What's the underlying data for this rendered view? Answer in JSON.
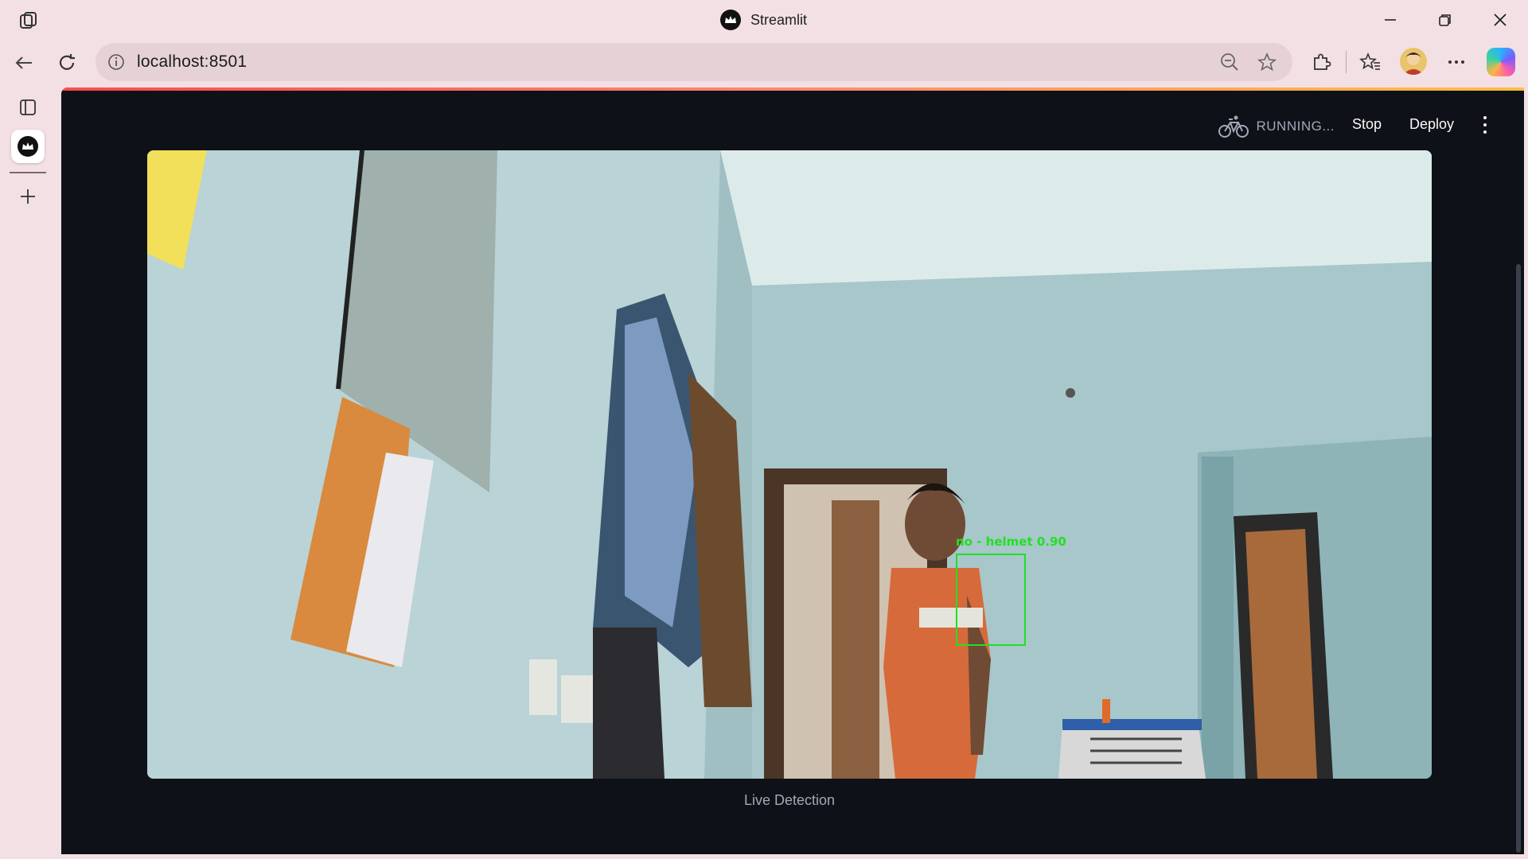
{
  "window": {
    "title": "Streamlit"
  },
  "addressbar": {
    "url": "localhost:8501"
  },
  "icons": {
    "workspaces": "workspaces-icon",
    "back": "back-arrow-icon",
    "refresh": "refresh-icon",
    "site_info": "info-icon",
    "zoom": "zoom-out-icon",
    "favorite": "star-icon",
    "extensions": "puzzle-icon",
    "favorites_bar": "favorites-icon",
    "more": "ellipsis-icon",
    "copilot": "copilot-icon"
  },
  "app": {
    "status_text": "RUNNING...",
    "stop_label": "Stop",
    "deploy_label": "Deploy",
    "caption": "Live Detection",
    "detection_label": "no - helmet 0.90"
  },
  "colors": {
    "app_background": "#0e1117",
    "browser_chrome": "#f3e0e4",
    "detection_box": "#22e022",
    "accent_gradient": "#ff4b4b"
  }
}
